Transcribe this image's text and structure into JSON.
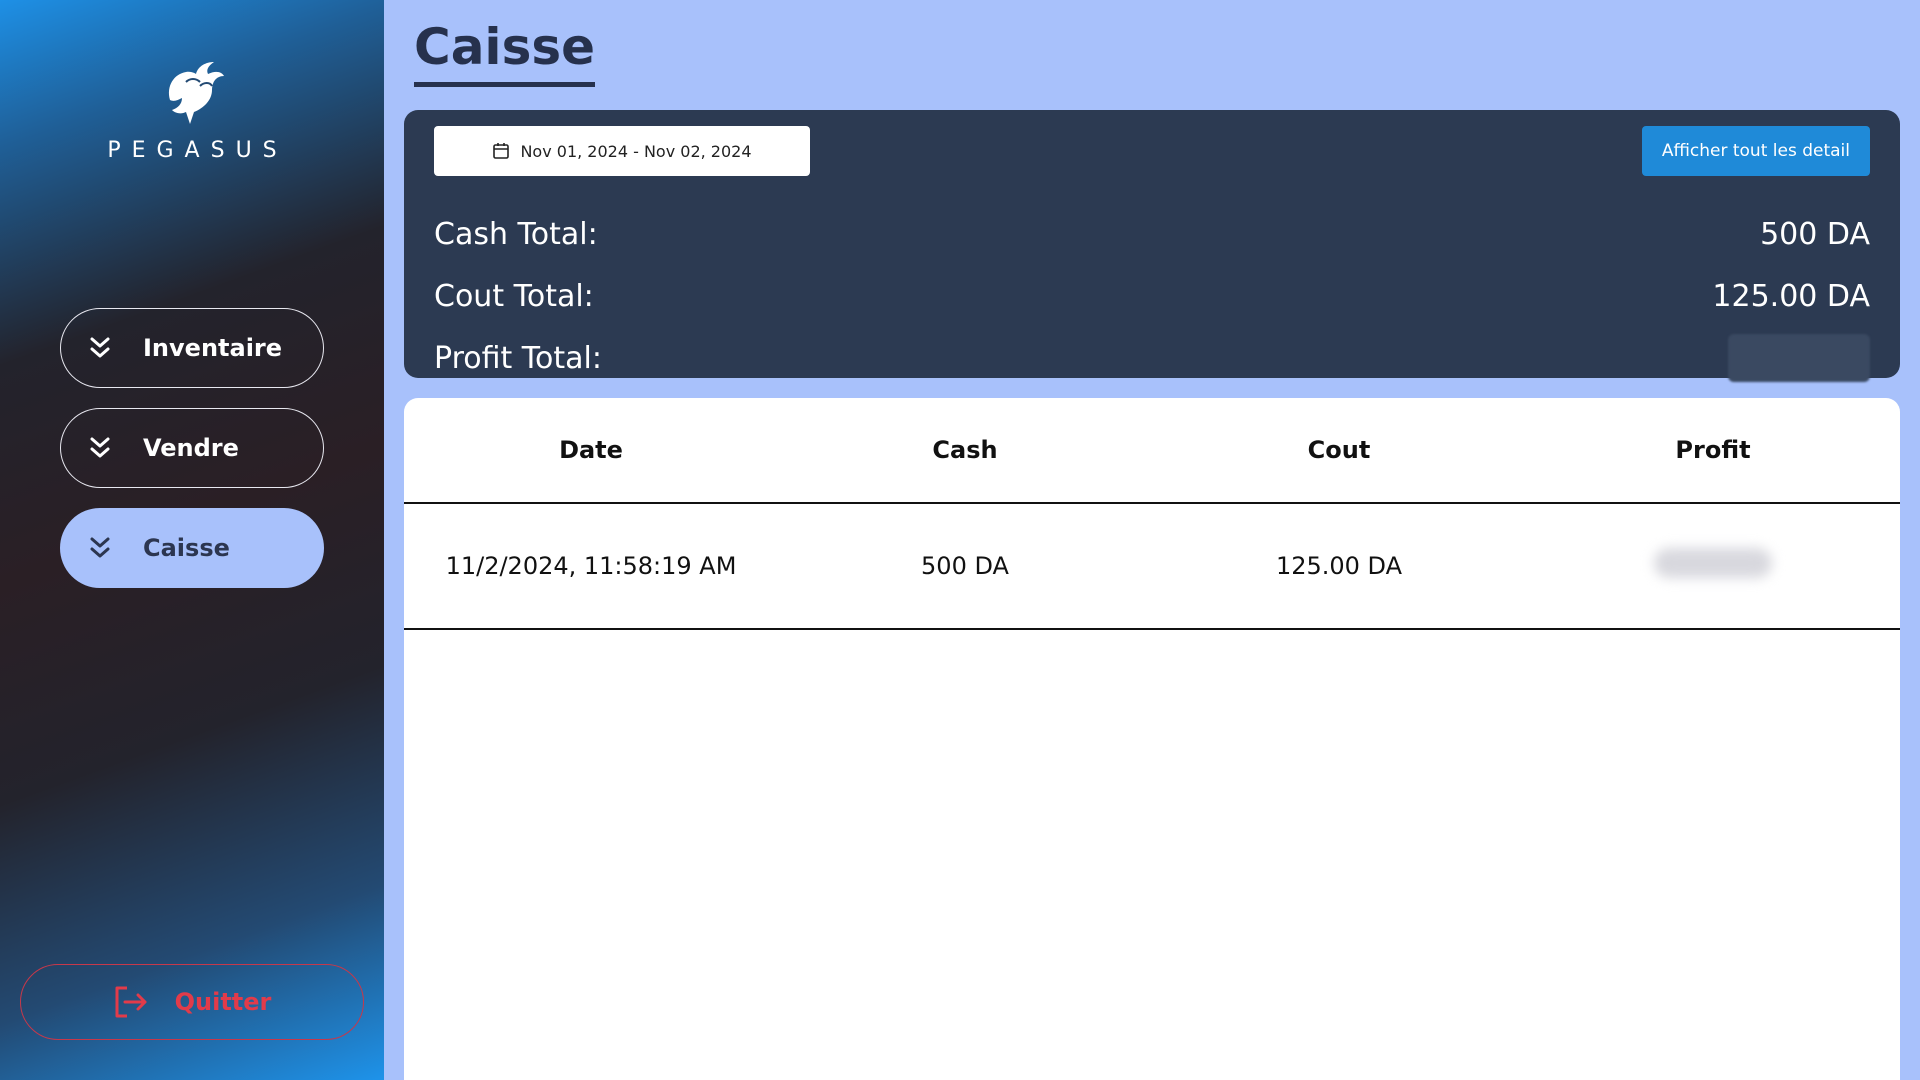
{
  "brand": {
    "name": "PEGASUS"
  },
  "sidebar": {
    "items": [
      {
        "label": "Inventaire",
        "icon": "double-chevron-down-icon",
        "active": false
      },
      {
        "label": "Vendre",
        "icon": "double-chevron-down-icon",
        "active": false
      },
      {
        "label": "Caisse",
        "icon": "double-chevron-down-icon",
        "active": true
      }
    ],
    "quit_label": "Quitter"
  },
  "page": {
    "title": "Caisse"
  },
  "summary": {
    "date_range": "Nov 01, 2024 - Nov 02, 2024",
    "detail_button": "Afficher tout les detail",
    "cash_label": "Cash Total:",
    "cash_value": "500 DA",
    "cout_label": "Cout Total:",
    "cout_value": "125.00 DA",
    "profit_label": "Profit Total:"
  },
  "table": {
    "headers": [
      "Date",
      "Cash",
      "Cout",
      "Profit"
    ],
    "rows": [
      {
        "date": "11/2/2024, 11:58:19 AM",
        "cash": "500 DA",
        "cout": "125.00 DA"
      }
    ]
  },
  "colors": {
    "main_bg": "#a8c1fb",
    "panel": "#2c3a52",
    "accent": "#1f8ad8",
    "danger": "#e23b4a"
  }
}
